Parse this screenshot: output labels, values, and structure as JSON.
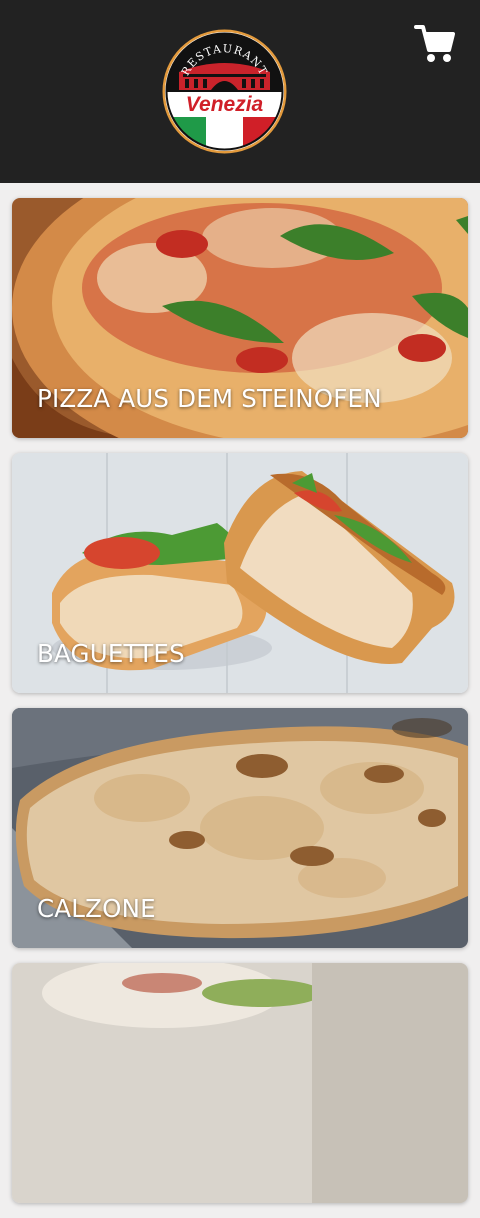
{
  "header": {
    "logo": {
      "top_text": "RESTAURANT",
      "brand_text": "Venezia",
      "icon": "restaurant-logo"
    },
    "cart_icon": "shopping-cart-icon"
  },
  "categories": [
    {
      "label": "PIZZA AUS DEM STEINOFEN",
      "image": "pizza-photo"
    },
    {
      "label": "BAGUETTES",
      "image": "baguette-photo"
    },
    {
      "label": "CALZONE",
      "image": "calzone-photo"
    }
  ],
  "colors": {
    "header_bg": "#222222",
    "page_bg": "#f0efef",
    "logo_red": "#d01f28",
    "logo_green": "#1f9a48",
    "logo_gold": "#e39a3c"
  }
}
